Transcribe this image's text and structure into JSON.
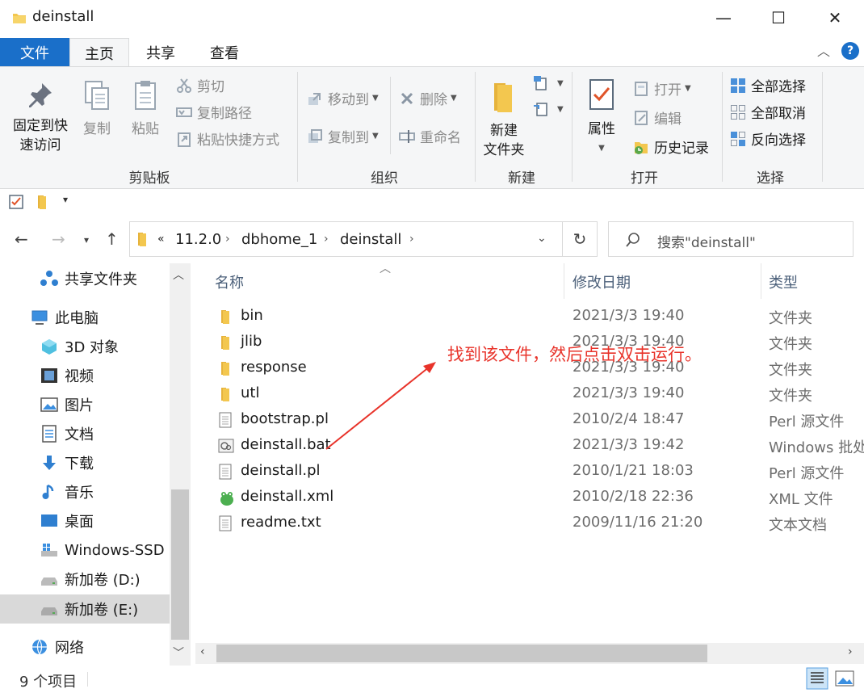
{
  "window": {
    "title": "deinstall",
    "minimize": "—",
    "maximize": "☐",
    "close": "✕"
  },
  "tabs": {
    "file": "文件",
    "home": "主页",
    "share": "共享",
    "view": "查看"
  },
  "help": "?",
  "ribbon": {
    "clipboard": {
      "pin": "固定到快速访问",
      "pin_l1": "固定到快",
      "pin_l2": "速访问",
      "copy": "复制",
      "paste": "粘贴",
      "cut": "剪切",
      "copy_path": "复制路径",
      "paste_shortcut": "粘贴快捷方式",
      "label": "剪贴板"
    },
    "organize": {
      "move_to": "移动到",
      "copy_to": "复制到",
      "delete": "删除",
      "rename": "重命名",
      "label": "组织"
    },
    "new": {
      "new_folder_l1": "新建",
      "new_folder_l2": "文件夹",
      "label": "新建"
    },
    "open": {
      "properties": "属性",
      "open": "打开",
      "edit": "编辑",
      "history": "历史记录",
      "label": "打开"
    },
    "select": {
      "select_all": "全部选择",
      "select_none": "全部取消",
      "invert": "反向选择",
      "label": "选择"
    }
  },
  "address": {
    "overflow": "«",
    "crumbs": [
      "11.2.0",
      "dbhome_1",
      "deinstall"
    ],
    "search_placeholder": "搜索\"deinstall\""
  },
  "nav": {
    "items": [
      {
        "label": "共享文件夹",
        "icon": "share-icon"
      },
      {
        "label": "此电脑",
        "icon": "computer-icon"
      },
      {
        "label": "3D 对象",
        "icon": "cube-icon"
      },
      {
        "label": "视频",
        "icon": "video-icon"
      },
      {
        "label": "图片",
        "icon": "picture-icon"
      },
      {
        "label": "文档",
        "icon": "document-icon"
      },
      {
        "label": "下载",
        "icon": "download-icon"
      },
      {
        "label": "音乐",
        "icon": "music-icon"
      },
      {
        "label": "桌面",
        "icon": "desktop-icon"
      },
      {
        "label": "Windows-SSD (",
        "icon": "drive-icon"
      },
      {
        "label": "新加卷 (D:)",
        "icon": "drive-icon"
      },
      {
        "label": "新加卷 (E:)",
        "icon": "drive-icon"
      },
      {
        "label": "网络",
        "icon": "network-icon"
      }
    ]
  },
  "columns": {
    "name": "名称",
    "date": "修改日期",
    "type": "类型"
  },
  "files": [
    {
      "name": "bin",
      "date": "2021/3/3 19:40",
      "type": "文件夹",
      "icon": "folder-icon"
    },
    {
      "name": "jlib",
      "date": "2021/3/3 19:40",
      "type": "文件夹",
      "icon": "folder-icon"
    },
    {
      "name": "response",
      "date": "2021/3/3 19:40",
      "type": "文件夹",
      "icon": "folder-icon"
    },
    {
      "name": "utl",
      "date": "2021/3/3 19:40",
      "type": "文件夹",
      "icon": "folder-icon"
    },
    {
      "name": "bootstrap.pl",
      "date": "2010/2/4 18:47",
      "type": "Perl 源文件",
      "icon": "file-icon"
    },
    {
      "name": "deinstall.bat",
      "date": "2021/3/3 19:42",
      "type": "Windows 批处",
      "icon": "bat-icon"
    },
    {
      "name": "deinstall.pl",
      "date": "2010/1/21 18:03",
      "type": "Perl 源文件",
      "icon": "file-icon"
    },
    {
      "name": "deinstall.xml",
      "date": "2010/2/18 22:36",
      "type": "XML 文件",
      "icon": "xml-icon"
    },
    {
      "name": "readme.txt",
      "date": "2009/11/16 21:20",
      "type": "文本文档",
      "icon": "file-icon"
    }
  ],
  "status": {
    "count": "9 个项目"
  },
  "annotation": {
    "text": "找到该文件，然后点击双击运行。",
    "color": "#e8332a"
  },
  "colors": {
    "accent": "#1a6fc9",
    "folder": "#f3c74f"
  }
}
